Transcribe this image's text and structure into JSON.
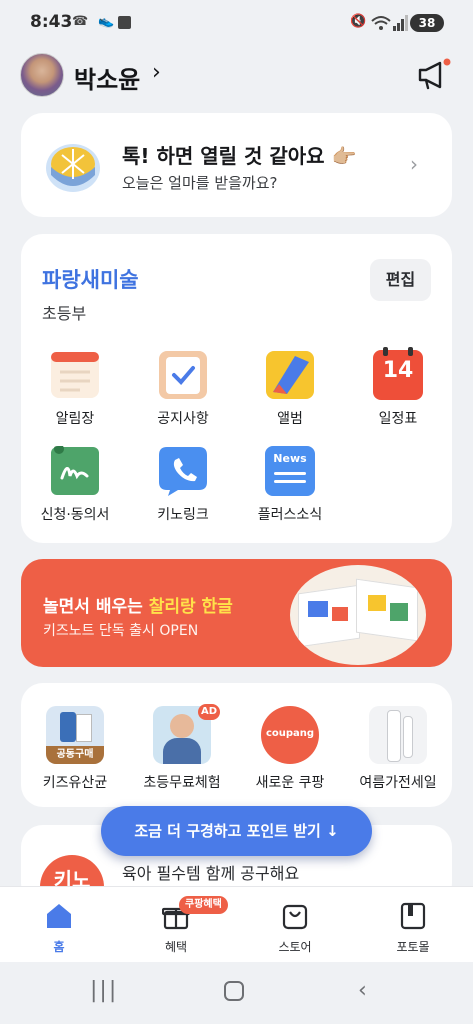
{
  "status": {
    "time": "8:43",
    "battery": "38"
  },
  "user": {
    "name": "박소윤",
    "chevron": "›"
  },
  "allowance_card": {
    "title": "톡! 하면 열릴 것 같아요 👉🏼",
    "subtitle": "오늘은 얼마를 받을까요?"
  },
  "class_card": {
    "school": "파랑새미술",
    "grade": "초등부",
    "edit_label": "편집",
    "menu": [
      {
        "label": "알림장",
        "icon": "notebook-icon"
      },
      {
        "label": "공지사항",
        "icon": "checklist-icon"
      },
      {
        "label": "앨범",
        "icon": "album-icon"
      },
      {
        "label": "일정표",
        "icon": "calendar-icon",
        "day": "14"
      },
      {
        "label": "신청·동의서",
        "icon": "signature-icon"
      },
      {
        "label": "키노링크",
        "icon": "phone-icon"
      },
      {
        "label": "플러스소식",
        "icon": "news-icon",
        "badge": "News"
      }
    ]
  },
  "banner": {
    "title_prefix": "놀면서 배우는 ",
    "title_highlight": "찰리랑 한글",
    "subtitle": "키즈노트 단독 출시 OPEN"
  },
  "promos": [
    {
      "label": "키즈유산균",
      "tag": "공동구매"
    },
    {
      "label": "초등무료체험",
      "tag": "AD"
    },
    {
      "label": "새로운 쿠팡",
      "tag": "coupang"
    },
    {
      "label": "여름가전세일",
      "tag": ""
    }
  ],
  "group_buy": {
    "icon_text": "키노",
    "text": "육아 필수템 함께 공구해요"
  },
  "floating_button": {
    "label": "조금 더 구경하고 포인트 받기 ↓"
  },
  "tabs": [
    {
      "label": "홈",
      "active": true
    },
    {
      "label": "혜택",
      "badge": "쿠팡혜택"
    },
    {
      "label": "스토어"
    },
    {
      "label": "포토몰"
    }
  ],
  "colors": {
    "accent": "#3f73e0",
    "banner": "#ee5f46",
    "highlight": "#ffe24a",
    "float_button": "#4a7be8"
  }
}
